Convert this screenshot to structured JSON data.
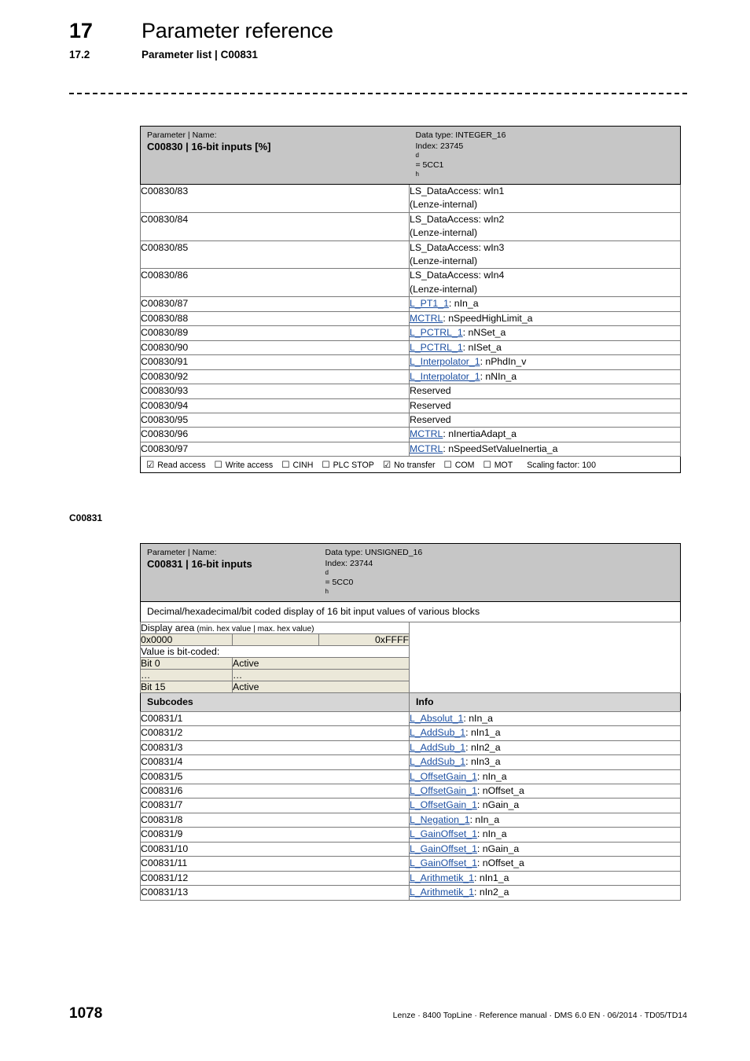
{
  "header": {
    "chapter_number": "17",
    "chapter_title": "Parameter reference",
    "section_number": "17.2",
    "section_title": "Parameter list | C00831"
  },
  "margin_label": "C00831",
  "table_c00830": {
    "head_small": "Parameter | Name:",
    "head_big": "C00830 | 16-bit inputs [%]",
    "data_type": "Data type: INTEGER_16",
    "index_prefix": "Index: 23745",
    "index_sub1": "d",
    "index_mid": " = 5CC1",
    "index_sub2": "h",
    "rows": [
      {
        "code": "C00830/83",
        "link": "",
        "text": "LS_DataAccess: wIn1\n(Lenze-internal)"
      },
      {
        "code": "C00830/84",
        "link": "",
        "text": "LS_DataAccess: wIn2\n(Lenze-internal)"
      },
      {
        "code": "C00830/85",
        "link": "",
        "text": "LS_DataAccess: wIn3\n(Lenze-internal)"
      },
      {
        "code": "C00830/86",
        "link": "",
        "text": "LS_DataAccess: wIn4\n(Lenze-internal)"
      },
      {
        "code": "C00830/87",
        "link": "L_PT1_1",
        "text": ": nIn_a"
      },
      {
        "code": "C00830/88",
        "link": "MCTRL",
        "text": ": nSpeedHighLimit_a"
      },
      {
        "code": "C00830/89",
        "link": "L_PCTRL_1",
        "text": ": nNSet_a"
      },
      {
        "code": "C00830/90",
        "link": "L_PCTRL_1",
        "text": ": nISet_a"
      },
      {
        "code": "C00830/91",
        "link": "L_Interpolator_1",
        "text": ": nPhdIn_v"
      },
      {
        "code": "C00830/92",
        "link": "L_Interpolator_1",
        "text": ": nNIn_a"
      },
      {
        "code": "C00830/93",
        "link": "",
        "text": "Reserved"
      },
      {
        "code": "C00830/94",
        "link": "",
        "text": "Reserved"
      },
      {
        "code": "C00830/95",
        "link": "",
        "text": "Reserved"
      },
      {
        "code": "C00830/96",
        "link": "MCTRL",
        "text": ": nInertiaAdapt_a"
      },
      {
        "code": "C00830/97",
        "link": "MCTRL",
        "text": ": nSpeedSetValueInertia_a"
      }
    ],
    "legend": [
      {
        "checked": true,
        "label": "Read access"
      },
      {
        "checked": false,
        "label": "Write access"
      },
      {
        "checked": false,
        "label": "CINH"
      },
      {
        "checked": false,
        "label": "PLC STOP"
      },
      {
        "checked": true,
        "label": "No transfer"
      },
      {
        "checked": false,
        "label": "COM"
      },
      {
        "checked": false,
        "label": "MOT"
      }
    ],
    "scaling_factor": "Scaling factor: 100"
  },
  "table_c00831": {
    "head_small": "Parameter | Name:",
    "head_big": "C00831 | 16-bit inputs",
    "data_type": "Data type: UNSIGNED_16",
    "index_prefix": "Index: 23744",
    "index_sub1": "d",
    "index_mid": " = 5CC0",
    "index_sub2": "h",
    "description": "Decimal/hexadecimal/bit coded display of 16 bit input values of various blocks",
    "display_area_title": "Display area",
    "display_area_paren": "(min. hex value | max. hex value)",
    "hex_min": "0x0000",
    "hex_mid": "",
    "hex_max": "0xFFFF",
    "bitcoded_title": "Value is bit-coded:",
    "bits": [
      {
        "label": "Bit 0",
        "value": "Active"
      },
      {
        "label": "…",
        "value": "…"
      },
      {
        "label": "Bit 15",
        "value": "Active"
      }
    ],
    "subcodes_header": "Subcodes",
    "info_header": "Info",
    "rows": [
      {
        "code": "C00831/1",
        "link": "L_Absolut_1",
        "text": ": nIn_a"
      },
      {
        "code": "C00831/2",
        "link": "L_AddSub_1",
        "text": ": nIn1_a"
      },
      {
        "code": "C00831/3",
        "link": "L_AddSub_1",
        "text": ": nIn2_a"
      },
      {
        "code": "C00831/4",
        "link": "L_AddSub_1",
        "text": ": nIn3_a"
      },
      {
        "code": "C00831/5",
        "link": "L_OffsetGain_1",
        "text": ": nIn_a"
      },
      {
        "code": "C00831/6",
        "link": "L_OffsetGain_1",
        "text": ": nOffset_a"
      },
      {
        "code": "C00831/7",
        "link": "L_OffsetGain_1",
        "text": ": nGain_a"
      },
      {
        "code": "C00831/8",
        "link": "L_Negation_1",
        "text": ": nIn_a"
      },
      {
        "code": "C00831/9",
        "link": "L_GainOffset_1",
        "text": ": nIn_a"
      },
      {
        "code": "C00831/10",
        "link": "L_GainOffset_1",
        "text": ": nGain_a"
      },
      {
        "code": "C00831/11",
        "link": "L_GainOffset_1",
        "text": ": nOffset_a"
      },
      {
        "code": "C00831/12",
        "link": "L_Arithmetik_1",
        "text": ": nIn1_a"
      },
      {
        "code": "C00831/13",
        "link": "L_Arithmetik_1",
        "text": ": nIn2_a"
      }
    ]
  },
  "footer": {
    "page_number": "1078",
    "text": "Lenze · 8400 TopLine · Reference manual · DMS 6.0 EN · 06/2014 · TD05/TD14"
  },
  "icons": {
    "checkbox_checked": "☑",
    "checkbox_unchecked": "☐"
  },
  "colors": {
    "header_band": "#c6c6c6",
    "subheader_band": "#d6d6d6",
    "beige_row": "#ebe8d9",
    "link": "#1c4fa1"
  }
}
